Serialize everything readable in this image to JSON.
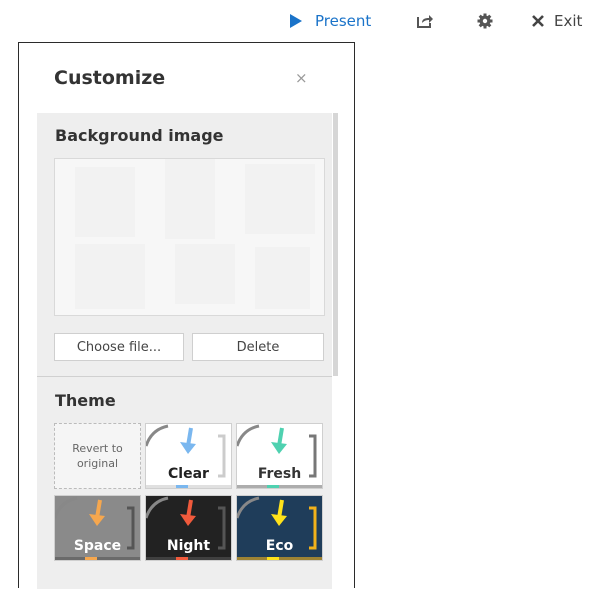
{
  "toolbar": {
    "present_label": "Present",
    "exit_label": "Exit",
    "accent_color": "#1a73c9"
  },
  "panel": {
    "title": "Customize",
    "close_glyph": "×",
    "background": {
      "title": "Background image",
      "choose_label": "Choose file...",
      "delete_label": "Delete"
    },
    "theme": {
      "title": "Theme",
      "revert_label": "Revert to original",
      "themes": [
        {
          "label": "Clear",
          "bg": "#ffffff",
          "text": "#222222",
          "arrow": "#7ab7ef",
          "bracket": "#cccccc"
        },
        {
          "label": "Fresh",
          "bg": "#ffffff",
          "text": "#333333",
          "arrow": "#4fd1b0",
          "bracket": "#777777"
        },
        {
          "label": "Space",
          "bg": "#8a8a8a",
          "text": "#ffffff",
          "arrow": "#f6a74e",
          "bracket": "#555555"
        },
        {
          "label": "Night",
          "bg": "#222222",
          "text": "#ffffff",
          "arrow": "#f05a3c",
          "bracket": "#555555"
        },
        {
          "label": "Eco",
          "bg": "#1f3d5a",
          "text": "#ffffff",
          "arrow": "#ffe21a",
          "bracket": "#f2b21b"
        }
      ]
    }
  }
}
